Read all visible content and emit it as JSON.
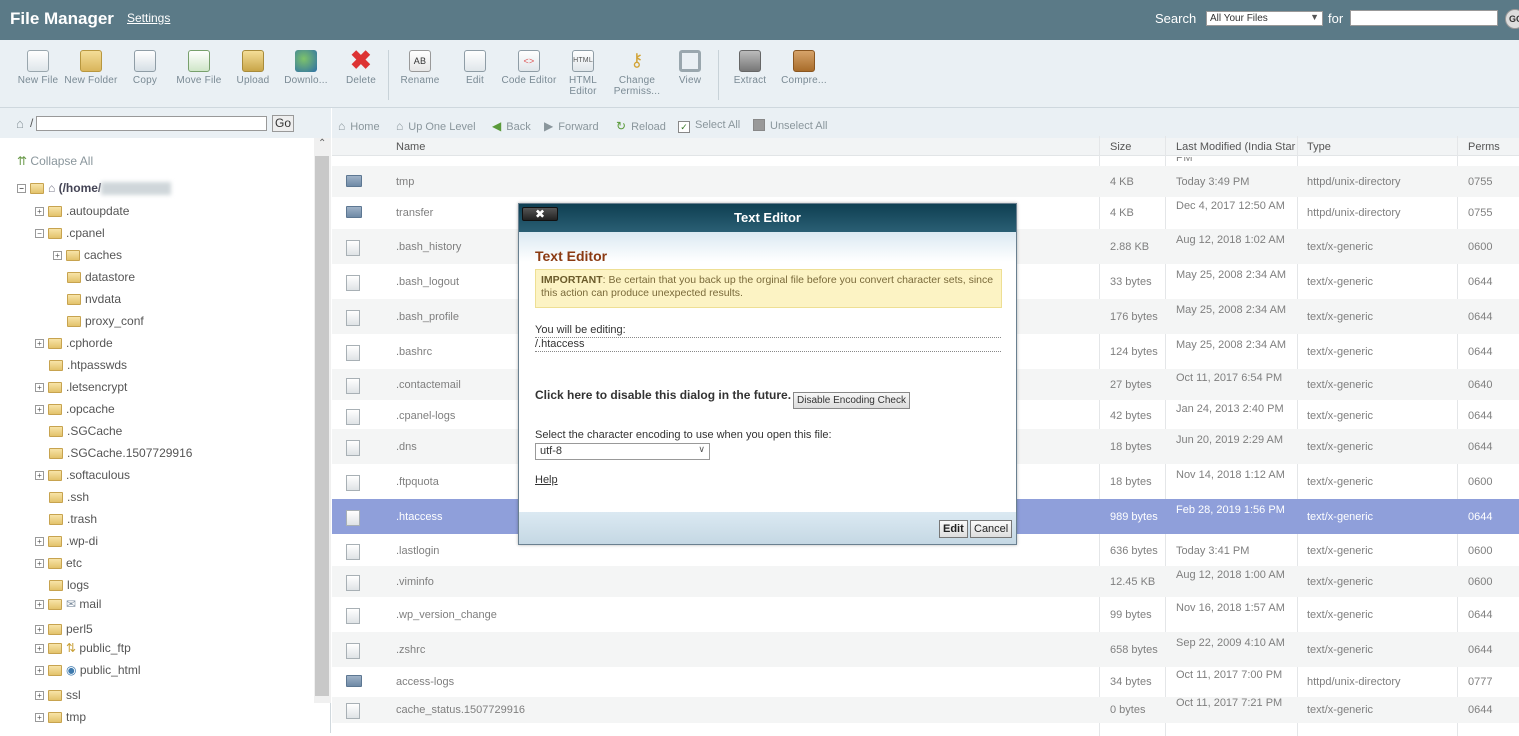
{
  "header": {
    "title": "File Manager",
    "settings": "Settings",
    "search_label": "Search",
    "search_scope": "All Your Files",
    "for_label": "for",
    "go_label": "GO"
  },
  "toolbar": {
    "new_file": "New File",
    "new_folder": "New Folder",
    "copy": "Copy",
    "move_file": "Move File",
    "upload": "Upload",
    "download": "Downlo...",
    "delete": "Delete",
    "rename": "Rename",
    "edit": "Edit",
    "code_editor": "Code Editor",
    "html_editor": "HTML Editor",
    "change_perms": "Change Permiss...",
    "view": "View",
    "extract": "Extract",
    "compress": "Compre..."
  },
  "left": {
    "path_prefix": "/",
    "go": "Go",
    "collapse_all": "Collapse All",
    "root": "(/home/",
    "tree": [
      ".autoupdate",
      ".cpanel",
      "caches",
      "datastore",
      "nvdata",
      "proxy_conf",
      ".cphorde",
      ".htpasswds",
      ".letsencrypt",
      ".opcache",
      ".SGCache",
      ".SGCache.1507729916",
      ".softaculous",
      ".ssh",
      ".trash",
      ".wp-di",
      "etc",
      "logs",
      "mail",
      "perl5",
      "public_ftp",
      "public_html",
      "ssl",
      "tmp"
    ]
  },
  "nav": {
    "home": "Home",
    "up": "Up One Level",
    "back": "Back",
    "forward": "Forward",
    "reload": "Reload",
    "select_all": "Select All",
    "unselect_all": "Unselect All"
  },
  "table": {
    "headers": [
      "Name",
      "Size",
      "Last Modified (India Star",
      "Type",
      "Perms"
    ],
    "top_partial": "PM",
    "rows": [
      {
        "name": "tmp",
        "size": "4 KB",
        "modified": "Today 3:49 PM",
        "type": "httpd/unix-directory",
        "perms": "0755",
        "kind": "dir"
      },
      {
        "name": "transfer",
        "size": "4 KB",
        "modified": "Dec 4, 2017 12:50 AM",
        "type": "httpd/unix-directory",
        "perms": "0755",
        "kind": "dir"
      },
      {
        "name": ".bash_history",
        "size": "2.88 KB",
        "modified": "Aug 12, 2018 1:02 AM",
        "type": "text/x-generic",
        "perms": "0600",
        "kind": "file"
      },
      {
        "name": ".bash_logout",
        "size": "33 bytes",
        "modified": "May 25, 2008 2:34 AM",
        "type": "text/x-generic",
        "perms": "0644",
        "kind": "file"
      },
      {
        "name": ".bash_profile",
        "size": "176 bytes",
        "modified": "May 25, 2008 2:34 AM",
        "type": "text/x-generic",
        "perms": "0644",
        "kind": "file"
      },
      {
        "name": ".bashrc",
        "size": "124 bytes",
        "modified": "May 25, 2008 2:34 AM",
        "type": "text/x-generic",
        "perms": "0644",
        "kind": "file"
      },
      {
        "name": ".contactemail",
        "size": "27 bytes",
        "modified": "Oct 11, 2017 6:54 PM",
        "type": "text/x-generic",
        "perms": "0640",
        "kind": "file"
      },
      {
        "name": ".cpanel-logs",
        "size": "42 bytes",
        "modified": "Jan 24, 2013 2:40 PM",
        "type": "text/x-generic",
        "perms": "0644",
        "kind": "file"
      },
      {
        "name": ".dns",
        "size": "18 bytes",
        "modified": "Jun 20, 2019 2:29 AM",
        "type": "text/x-generic",
        "perms": "0644",
        "kind": "file"
      },
      {
        "name": ".ftpquota",
        "size": "18 bytes",
        "modified": "Nov 14, 2018 1:12 AM",
        "type": "text/x-generic",
        "perms": "0600",
        "kind": "file"
      },
      {
        "name": ".htaccess",
        "size": "989 bytes",
        "modified": "Feb 28, 2019 1:56 PM",
        "type": "text/x-generic",
        "perms": "0644",
        "kind": "file"
      },
      {
        "name": ".lastlogin",
        "size": "636 bytes",
        "modified": "Today 3:41 PM",
        "type": "text/x-generic",
        "perms": "0600",
        "kind": "file"
      },
      {
        "name": ".viminfo",
        "size": "12.45 KB",
        "modified": "Aug 12, 2018 1:00 AM",
        "type": "text/x-generic",
        "perms": "0600",
        "kind": "file"
      },
      {
        "name": ".wp_version_change",
        "size": "99 bytes",
        "modified": "Nov 16, 2018 1:57 AM",
        "type": "text/x-generic",
        "perms": "0644",
        "kind": "file"
      },
      {
        "name": ".zshrc",
        "size": "658 bytes",
        "modified": "Sep 22, 2009 4:10 AM",
        "type": "text/x-generic",
        "perms": "0644",
        "kind": "file"
      },
      {
        "name": "access-logs",
        "size": "34 bytes",
        "modified": "Oct 11, 2017 7:00 PM",
        "type": "httpd/unix-directory",
        "perms": "0777",
        "kind": "dir"
      },
      {
        "name": "cache_status.1507729916",
        "size": "0 bytes",
        "modified": "Oct 11, 2017 7:21 PM",
        "type": "text/x-generic",
        "perms": "0644",
        "kind": "file"
      }
    ]
  },
  "dialog": {
    "close": "✖",
    "header": "Text Editor",
    "title": "Text Editor",
    "important_bold": "IMPORTANT",
    "important_text": ": Be certain that you back up the orginal file before you convert character sets, since this action can produce unexpected results.",
    "editing_label": "You will be editing:",
    "editing_file": "/.htaccess",
    "disable_text": "Click here to disable this dialog in the future.",
    "disable_button": "Disable Encoding Check",
    "encoding_label": "Select the character encoding to use when you open this file:",
    "encoding_value": "utf-8",
    "help": "Help",
    "edit_button": "Edit",
    "cancel_button": "Cancel"
  }
}
